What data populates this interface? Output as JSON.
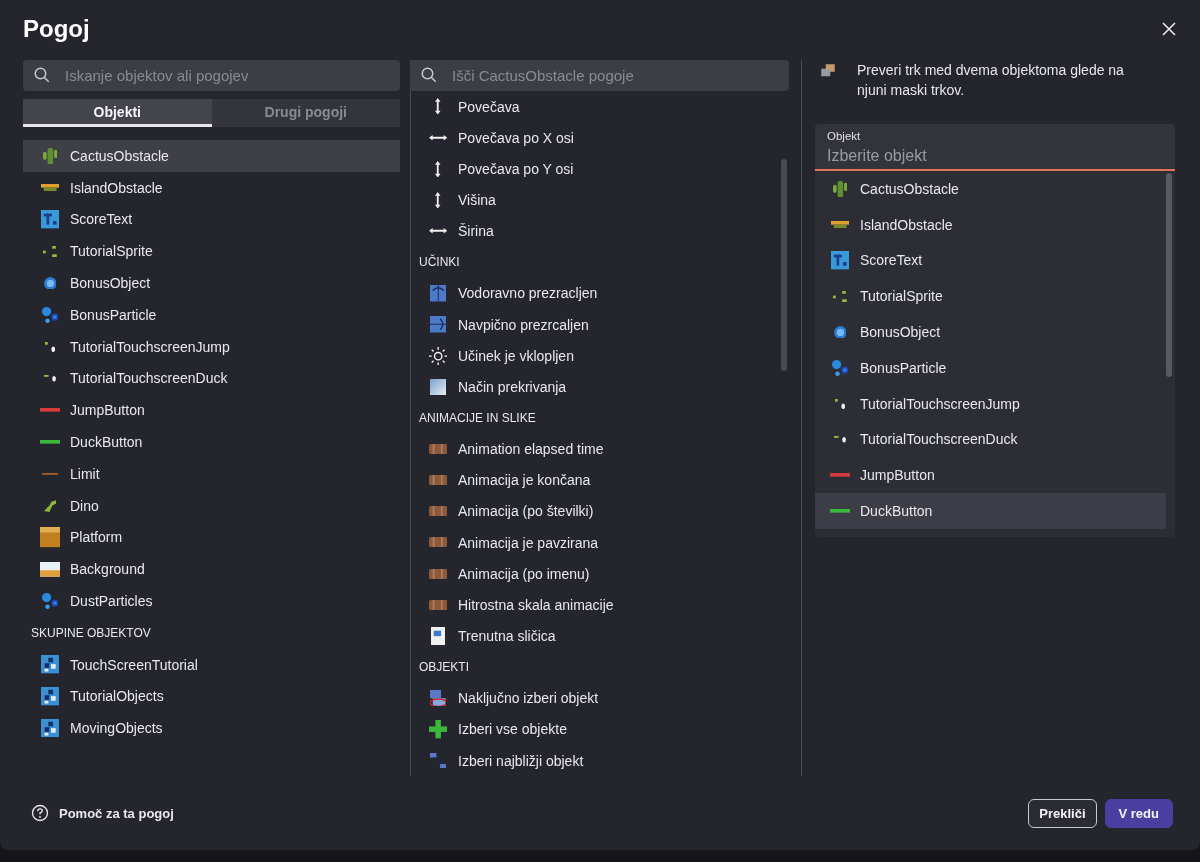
{
  "dialog": {
    "title": "Pogoj"
  },
  "left": {
    "search": {
      "placeholder": "Iskanje objektov ali pogojev"
    },
    "tabs": [
      {
        "label": "Objekti",
        "selected": true
      },
      {
        "label": "Drugi pogoji",
        "selected": false
      }
    ],
    "objects": [
      {
        "label": "CactusObstacle",
        "kind": "cactus",
        "selected": true
      },
      {
        "label": "IslandObstacle",
        "kind": "island",
        "selected": false
      },
      {
        "label": "ScoreText",
        "kind": "text",
        "selected": false
      },
      {
        "label": "TutorialSprite",
        "kind": "sprite",
        "selected": false
      },
      {
        "label": "BonusObject",
        "kind": "orb",
        "selected": false
      },
      {
        "label": "BonusParticle",
        "kind": "particles",
        "selected": false
      },
      {
        "label": "TutorialTouchscreenJump",
        "kind": "touchjump",
        "selected": false
      },
      {
        "label": "TutorialTouchscreenDuck",
        "kind": "touchduck",
        "selected": false
      },
      {
        "label": "JumpButton",
        "kind": "redbar",
        "selected": false
      },
      {
        "label": "DuckButton",
        "kind": "greenbar",
        "selected": false
      },
      {
        "label": "Limit",
        "kind": "limit",
        "selected": false
      },
      {
        "label": "Dino",
        "kind": "dino",
        "selected": false
      },
      {
        "label": "Platform",
        "kind": "platform",
        "selected": false
      },
      {
        "label": "Background",
        "kind": "background",
        "selected": false
      },
      {
        "label": "DustParticles",
        "kind": "particles",
        "selected": false
      }
    ],
    "groups_heading": "SKUPINE OBJEKTOV",
    "groups": [
      {
        "label": "TouchScreenTutorial",
        "kind": "group",
        "selected": false
      },
      {
        "label": "TutorialObjects",
        "kind": "group",
        "selected": false
      },
      {
        "label": "MovingObjects",
        "kind": "group",
        "selected": false
      }
    ]
  },
  "middle": {
    "search": {
      "placeholder": "Išči CactusObstacle pogoje"
    },
    "sections": [
      {
        "items": [
          {
            "label": "Povečava",
            "kind": "vertical"
          },
          {
            "label": "Povečava po X osi",
            "kind": "horizontal"
          },
          {
            "label": "Povečava po Y osi",
            "kind": "vertical"
          },
          {
            "label": "Višina",
            "kind": "vertical"
          },
          {
            "label": "Širina",
            "kind": "horizontal"
          }
        ]
      },
      {
        "heading": "UČINKI",
        "items": [
          {
            "label": "Vodoravno prezracljen",
            "kind": "fliph"
          },
          {
            "label": "Navpično prezrcaljen",
            "kind": "flipv"
          },
          {
            "label": "Učinek je vklopljen",
            "kind": "sun"
          },
          {
            "label": "Način prekrivanja",
            "kind": "blend"
          }
        ]
      },
      {
        "heading": "ANIMACIJE IN SLIKE",
        "items": [
          {
            "label": "Animation elapsed time",
            "kind": "film"
          },
          {
            "label": "Animacija je končana",
            "kind": "film"
          },
          {
            "label": "Animacija (po številki)",
            "kind": "film"
          },
          {
            "label": "Animacija je pavzirana",
            "kind": "film"
          },
          {
            "label": "Animacija (po imenu)",
            "kind": "film"
          },
          {
            "label": "Hitrostna skala animacije",
            "kind": "film"
          },
          {
            "label": "Trenutna sličica",
            "kind": "frame"
          }
        ]
      },
      {
        "heading": "OBJEKTI",
        "items": [
          {
            "label": "Naključno izberi objekt",
            "kind": "random"
          },
          {
            "label": "Izberi vse objekte",
            "kind": "plus"
          },
          {
            "label": "Izberi najbližji objekt",
            "kind": "nearest"
          }
        ]
      }
    ]
  },
  "right": {
    "description": "Preveri trk med dvema objektoma glede na njuni maski trkov.",
    "field": {
      "label": "Objekt",
      "placeholder": "Izberite objekt"
    },
    "options": [
      {
        "label": "CactusObstacle",
        "kind": "cactus",
        "selected": false
      },
      {
        "label": "IslandObstacle",
        "kind": "island",
        "selected": false
      },
      {
        "label": "ScoreText",
        "kind": "text",
        "selected": false
      },
      {
        "label": "TutorialSprite",
        "kind": "sprite",
        "selected": false
      },
      {
        "label": "BonusObject",
        "kind": "orb",
        "selected": false
      },
      {
        "label": "BonusParticle",
        "kind": "particles",
        "selected": false
      },
      {
        "label": "TutorialTouchscreenJump",
        "kind": "touchjump",
        "selected": false
      },
      {
        "label": "TutorialTouchscreenDuck",
        "kind": "touchduck",
        "selected": false
      },
      {
        "label": "JumpButton",
        "kind": "redbar",
        "selected": false
      },
      {
        "label": "DuckButton",
        "kind": "greenbar",
        "selected": true
      }
    ]
  },
  "footer": {
    "help": "Pomoč za ta pogoj",
    "buttons": [
      {
        "label": "Prekliči",
        "kind": "secondary"
      },
      {
        "label": "V redu",
        "kind": "primary"
      }
    ]
  }
}
